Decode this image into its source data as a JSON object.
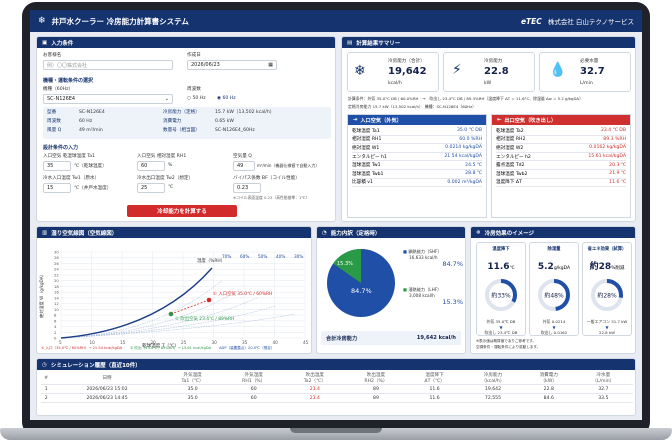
{
  "app": {
    "title": "井戸水クーラー 冷房能力計算書システム",
    "logo": "eTEC",
    "company": "株式会社 白山テクノサービス"
  },
  "input": {
    "header": "入力条件",
    "client_label": "お客様名",
    "client_placeholder": "例）〇〇株式会社",
    "date_label": "作成日",
    "date_value": "2026/06/23"
  },
  "equipment": {
    "header": "機種・運転条件の選択",
    "model_label": "機種（60Hz）",
    "model_value": "SC-N126E4",
    "freq_label": "周波数",
    "freq_50": "50 Hz",
    "freq_60": "60 Hz",
    "specs": [
      [
        "型番",
        "SC-N126E4"
      ],
      [
        "周波数",
        "60 Hz"
      ],
      [
        "風量 Q",
        "49 m³/min"
      ]
    ],
    "specs2": [
      [
        "冷房能力（定格）",
        "15.7 kW（13,502 kcal/h）"
      ],
      [
        "消費電力",
        "0.65 kW"
      ],
      [
        "数量号（相当図）",
        "SC-N126E4_60Hz"
      ]
    ]
  },
  "design": {
    "header": "設計条件の入力",
    "f1_label": "入口空気 乾湿球温度 Ta1",
    "f1_value": "35",
    "f1_unit": "℃（乾球温度）",
    "f2_label": "入口空気 相対湿度 RH1",
    "f2_value": "60",
    "f2_unit": "%",
    "f3_label": "空気量 Q",
    "f3_value": "49",
    "f3_unit": "m³/min（機器仕様値で自動入力）",
    "f4_label": "冷水入口温度 Tw1（原水）",
    "f4_value": "15",
    "f4_unit": "℃（井戸水温度）",
    "f5_label": "冷水出口温度 Tw2（想定）",
    "f5_value": "25",
    "f5_unit": "℃",
    "f6_label": "バイパス係数 BF（コイル性能）",
    "f6_value": "0.23",
    "f6_note": "※コイル表面温度 0.23（高性能基準：1℃）",
    "calc_button": "冷却能力を計算する"
  },
  "summary": {
    "header": "計算結果サマリー",
    "cards": [
      {
        "label": "冷房能力（合計）",
        "value": "19,642",
        "unit": "kcal/h"
      },
      {
        "label": "冷房能力",
        "value": "22.8",
        "unit": "kW"
      },
      {
        "label": "必要水量",
        "value": "32.7",
        "unit": "L/min"
      }
    ],
    "line1": "計算条件：外気 35.0°C DB / 60.0%RH　→　吹出し 23.4°C DB / 89.3%RH（温度降下 ΔT = 11.6°C、除湿量 Δw = 5.2 g/kgDA）",
    "line2": "定格冷房能力 15.7 kW（13,502 kcal/h）　機種：SC-N126E4（60Hz）"
  },
  "inlet": {
    "header": "入口空気（外気）",
    "rows": [
      [
        "乾球温度 Ta1",
        "35.0 ℃ DB"
      ],
      [
        "相対湿度 RH1",
        "60.0 %RH"
      ],
      [
        "絶対湿度 W1",
        "0.0214 kg/kgDA"
      ],
      [
        "エンタルピー h1",
        "21.54 kcal/kgDA"
      ],
      [
        "湿球温度 Tw1",
        "24.5 ℃"
      ],
      [
        "湿球温度 Twb1",
        "28.8 ℃"
      ],
      [
        "比容積 v1",
        "0.002 m³/kgDA"
      ]
    ]
  },
  "outlet": {
    "header": "出口空気（吹き出し）",
    "rows": [
      [
        "乾球温度 Ta2",
        "23.4 ℃ DB"
      ],
      [
        "相対湿度 RH2",
        "89.3 %RH"
      ],
      [
        "絶対湿度 W2",
        "0.0162 kg/kgDA"
      ],
      [
        "エンタルピー h2",
        "15.61 kcal/kgDA"
      ],
      [
        "露点温度 Td2",
        "20.3 ℃"
      ],
      [
        "湿球温度 Twb2",
        "21.9 ℃"
      ],
      [
        "温度降下 ΔT",
        "11.6 ℃"
      ]
    ]
  },
  "psy": {
    "header": "湿り空気線図（空気線図）",
    "in_label": "① 入口空気 35.0℃ / 60%RH",
    "out_label": "② 吹出空気 23.4℃ / 89%RH",
    "x_axis": "乾球温度 T（℃）",
    "y_axis": "絶対湿度 W（g/kgDA）",
    "rh_label": "湿度（%RH）",
    "x_ticks": [
      "5",
      "10",
      "15",
      "20",
      "25",
      "30",
      "35",
      "40",
      "45"
    ],
    "y_ticks": [
      "30",
      "28",
      "26",
      "24",
      "22",
      "20",
      "18",
      "16",
      "14",
      "12",
      "10",
      "8",
      "6",
      "4",
      "2",
      "0"
    ],
    "rh_ticks": [
      "70%",
      "60%",
      "50%",
      "40%",
      "30%"
    ],
    "legend": [
      "① 入口（35.0℃ / 60%RH）→ 21.54 kcal/kgDA",
      "② 吹出（23.4℃ / 89%RH）→ 15.61 kcal/kgDA",
      "ADP（装置露点）20.0℃（想定）"
    ]
  },
  "breakdown": {
    "header": "能力内訳（定格時）",
    "sensible_label": "顕熱能力（SHF）",
    "sensible_value": "16,633 kcal/h",
    "sensible_pct": "84.7%",
    "latent_label": "潜熱能力（LHF）",
    "latent_value": "3,008 kcal/h",
    "latent_pct": "15.3%",
    "pie_big": "84.7%",
    "pie_small": "15.3%",
    "total_label": "合計冷房能力",
    "total_value": "19,642 kcal/h",
    "chart_data": {
      "type": "pie",
      "categories": [
        "顕熱能力（SHF）",
        "潜熱能力（LHF）"
      ],
      "values": [
        84.7,
        15.3
      ]
    }
  },
  "effect": {
    "header": "冷房効果のイメージ",
    "c1": {
      "title": "温度降下",
      "value": "11.6",
      "unit": "℃",
      "ring": "約33%",
      "ring_pct": 33,
      "from": "外気 35.0℃ DB",
      "to": "吹出し 23.4℃ DB"
    },
    "c2": {
      "title": "除湿量",
      "value": "5.2",
      "unit": "g/kgDA",
      "ring": "約48%",
      "ring_pct": 48,
      "from": "外気 0.0214",
      "to": "吹出し 0.0162"
    },
    "c3": {
      "title": "省エネ効果（試算）",
      "value": "約28",
      "unit": "%削減",
      "ring": "約28%",
      "ring_pct": 28,
      "from": "一般エアコン 31.7 kW",
      "to": "22.8 kW"
    },
    "note1": "※表示値は概算値でありご参考です。",
    "note2": "空調条件・運転条件により変動します。"
  },
  "history": {
    "header": "シミュレーション履歴（直近10件）",
    "cols": [
      "#",
      "日時",
      "外気温度\nTa1（℃）",
      "外気湿度\nRH1（%）",
      "吹出温度\nTa2（℃）",
      "吹出湿度\nRH2（%）",
      "温度降下\nΔT（℃）",
      "冷房能力\n（kcal/h）",
      "消費電力\n（kW）",
      "冷水量\n（L/min）"
    ],
    "rows": [
      [
        "1",
        "2026/06/23 15:02",
        "35.0",
        "60",
        "23.4",
        "89",
        "11.6",
        "19,642",
        "22.8",
        "32.7"
      ],
      [
        "2",
        "2026/06/23 14:45",
        "35.0",
        "60",
        "23.4",
        "89",
        "11.6",
        "72,555",
        "84.6",
        "33.5"
      ]
    ]
  },
  "colors": {
    "navy": "#15336e",
    "red": "#d22b2b",
    "blue": "#1f4fa6",
    "green": "#2b9a47"
  }
}
